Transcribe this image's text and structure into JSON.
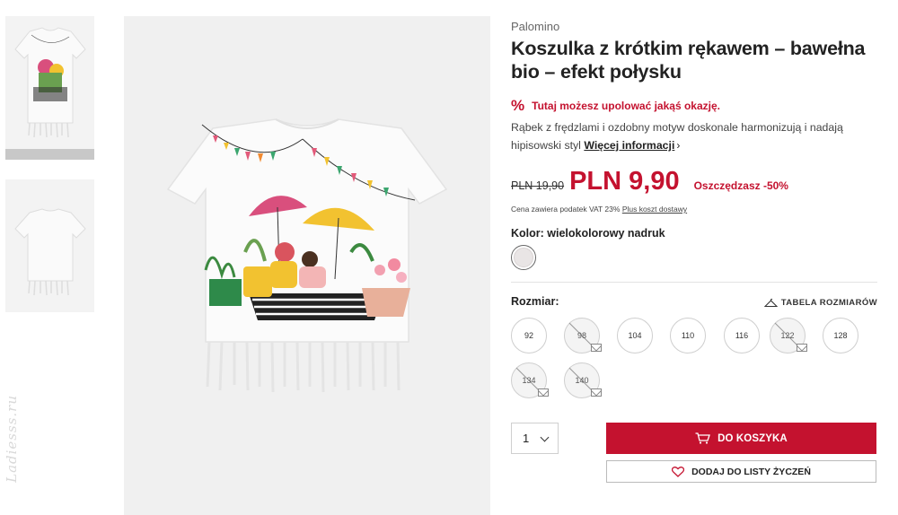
{
  "watermark": "Ladiesss.ru",
  "product": {
    "brand": "Palomino",
    "title": "Koszulka z krótkim rękawem – bawełna bio – efekt połysku",
    "promo": {
      "icon": "percent-icon",
      "text": "Tutaj możesz upolować jakąś okazję."
    },
    "description": "Rąbek z frędzlami i ozdobny motyw doskonale harmonizują i nadają hipisowski styl",
    "more_info": "Więcej informacji",
    "price": {
      "old": "PLN 19,90",
      "new": "PLN 9,90",
      "saving": "Oszczędzasz -50%"
    },
    "vat_text": "Cena zawiera podatek VAT 23%",
    "shipping_link": "Plus koszt dostawy",
    "color_label": "Kolor: wielokolorowy nadruk",
    "size_label": "Rozmiar:",
    "size_chart": "TABELA ROZMIARÓW",
    "sizes": [
      {
        "label": "92",
        "available": true
      },
      {
        "label": "98",
        "available": false
      },
      {
        "label": "104",
        "available": true
      },
      {
        "label": "110",
        "available": true
      },
      {
        "label": "116",
        "available": true
      },
      {
        "label": "122",
        "available": false
      },
      {
        "label": "128",
        "available": true
      },
      {
        "label": "134",
        "available": false
      },
      {
        "label": "140",
        "available": false
      }
    ],
    "quantity": "1",
    "add_to_cart": "DO KOSZYKA",
    "add_to_wishlist": "DODAJ DO LISTY ŻYCZEŃ"
  },
  "colors": {
    "accent": "#c4122f"
  }
}
